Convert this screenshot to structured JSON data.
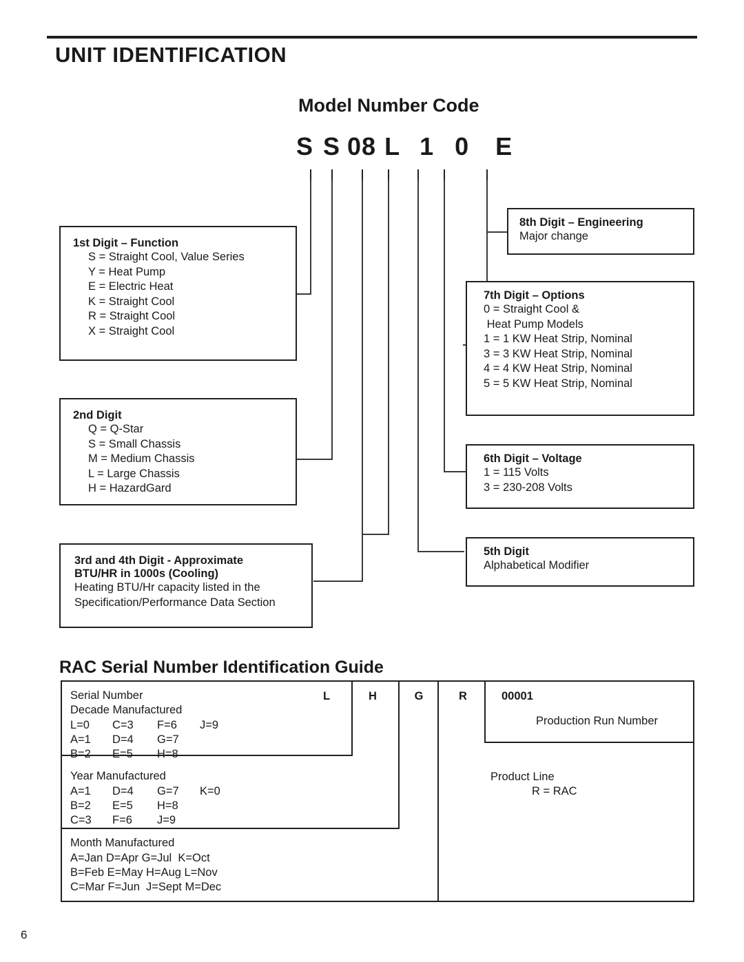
{
  "page": {
    "title": "UNIT IDENTIFICATION",
    "number": "6"
  },
  "model_section": {
    "title": "Model Number Code",
    "code_parts": [
      "S",
      "S",
      "08",
      "L",
      "1",
      "0",
      "E"
    ],
    "code_full": "S S 08 L 1 0 E"
  },
  "callouts": {
    "digit1": {
      "heading": "1st Digit – Function",
      "lines": [
        "S = Straight Cool, Value Series",
        "Y = Heat Pump",
        "E = Electric Heat",
        "K = Straight Cool",
        "R = Straight Cool",
        "X = Straight Cool"
      ]
    },
    "digit2": {
      "heading": "2nd Digit",
      "lines": [
        "Q = Q-Star",
        "S = Small Chassis",
        "M = Medium Chassis",
        "L = Large Chassis",
        "H = HazardGard"
      ]
    },
    "digit34": {
      "heading_line1": "3rd and 4th Digit - Approximate",
      "heading_line2": "BTU/HR in 1000s (Cooling)",
      "lines": [
        "Heating BTU/Hr capacity listed in the",
        "Specification/Performance Data Section"
      ]
    },
    "digit5": {
      "heading": "5th Digit",
      "lines": [
        "Alphabetical Modifier"
      ]
    },
    "digit6": {
      "heading": "6th Digit – Voltage",
      "lines": [
        "1 = 115 Volts",
        "3 = 230-208 Volts"
      ]
    },
    "digit7": {
      "heading": "7th Digit – Options",
      "lines": [
        "0 = Straight Cool &",
        " Heat Pump Models",
        "1 = 1 KW Heat Strip, Nominal",
        "3 = 3 KW Heat Strip, Nominal",
        "4 = 4 KW Heat Strip, Nominal",
        "5 = 5 KW Heat Strip, Nominal"
      ]
    },
    "digit8": {
      "heading": "8th Digit – Engineering",
      "lines": [
        "Major change"
      ]
    }
  },
  "serial_section": {
    "title": "RAC Serial Number Identification Guide",
    "serial_chars": [
      "L",
      "H",
      "G",
      "R"
    ],
    "run_number": "00001",
    "run_number_label": "Production Run Number",
    "product_line_label": "Product Line",
    "product_line_value": "R = RAC",
    "decade": {
      "title": "Serial Number",
      "subtitle": "Decade Manufactured",
      "rows": [
        [
          "L=0",
          "C=3",
          "F=6",
          "J=9"
        ],
        [
          "A=1",
          "D=4",
          "G=7",
          ""
        ],
        [
          "B=2",
          "E=5",
          "H=8",
          ""
        ]
      ]
    },
    "year": {
      "title": "Year Manufactured",
      "rows": [
        [
          "A=1",
          "D=4",
          "G=7",
          "K=0"
        ],
        [
          "B=2",
          "E=5",
          "H=8",
          ""
        ],
        [
          "C=3",
          "F=6",
          "J=9",
          ""
        ]
      ]
    },
    "month": {
      "title": "Month Manufactured",
      "rows": [
        "A=Jan D=Apr G=Jul  K=Oct",
        "B=Feb E=May H=Aug L=Nov",
        "C=Mar F=Jun  J=Sept M=Dec"
      ]
    }
  }
}
